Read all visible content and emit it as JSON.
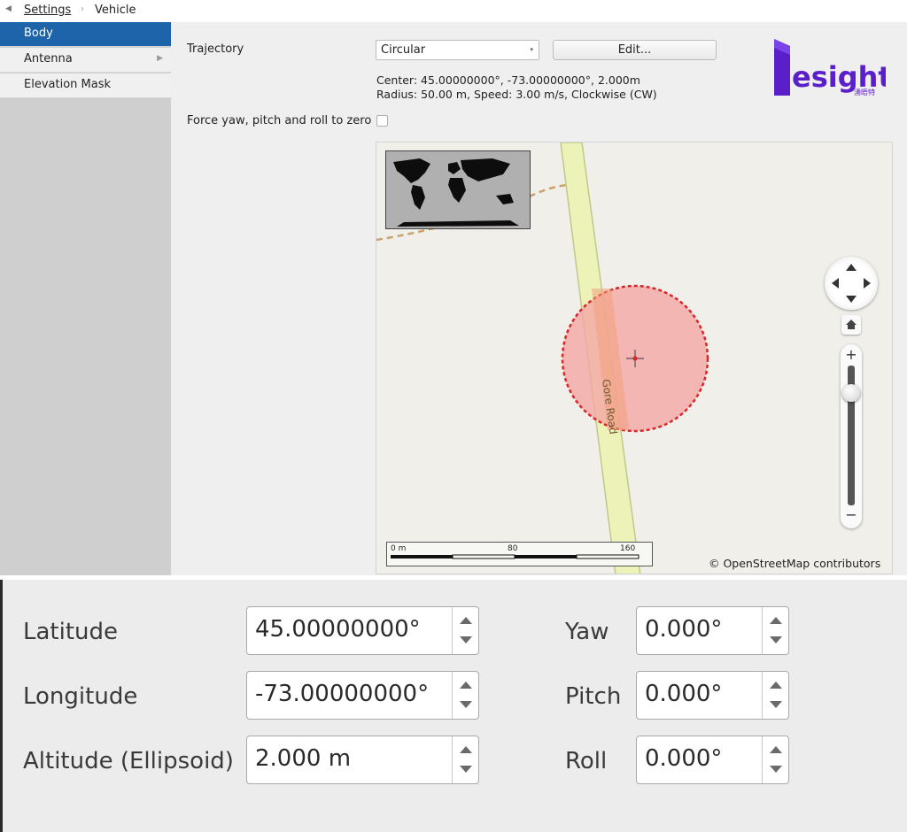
{
  "breadcrumb": {
    "back_icon": "◀",
    "settings": "Settings",
    "separator": "›",
    "current": "Vehicle"
  },
  "sidebar": {
    "items": [
      {
        "label": "Body",
        "active": true
      },
      {
        "label": "Antenna",
        "has_submenu": true,
        "arrow": "▶"
      },
      {
        "label": "Elevation Mask"
      }
    ]
  },
  "body": {
    "trajectory_label": "Trajectory",
    "trajectory_value": "Circular",
    "combo_caret": "▾",
    "edit_button": "Edit...",
    "center_info": "Center: 45.00000000°, -73.00000000°, 2.000m",
    "radius_info": "Radius: 50.00 m, Speed: 3.00 m/s, Clockwise (CW)",
    "force_label": "Force yaw, pitch and roll to zero",
    "force_checked": false
  },
  "logo": {
    "text": "esight",
    "subtext": "湧晤特",
    "color": "#5b1fc9"
  },
  "map": {
    "road_name": "Gore Road",
    "scale_labels": [
      "0 m",
      "80",
      "160"
    ],
    "attribution": "© OpenStreetMap contributors",
    "zoom_plus": "+",
    "zoom_minus": "−",
    "home_icon": "home-icon",
    "road_color": "#ecf2b8",
    "circle_color": "#f4a7a4",
    "circle_border": "#d9262a"
  },
  "position": {
    "latitude_label": "Latitude",
    "latitude": "45.00000000°",
    "longitude_label": "Longitude",
    "longitude": "-73.00000000°",
    "altitude_label": "Altitude (Ellipsoid)",
    "altitude": "2.000 m"
  },
  "orientation": {
    "yaw_label": "Yaw",
    "yaw": "0.000°",
    "pitch_label": "Pitch",
    "pitch": "0.000°",
    "roll_label": "Roll",
    "roll": "0.000°"
  }
}
